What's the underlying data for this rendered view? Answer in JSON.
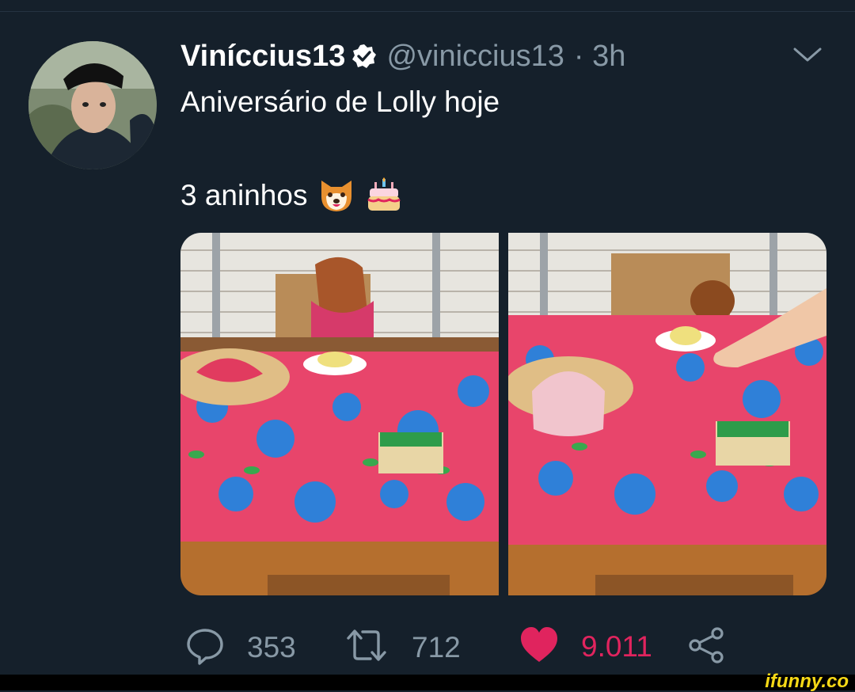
{
  "tweet": {
    "display_name": "Viníccius13",
    "handle": "@viniccius13",
    "time": "· 3h",
    "text_line1": "Aniversário de Lolly hoje",
    "text_line2": "3 aninhos"
  },
  "icons": {
    "verified": "verified-badge-icon",
    "menu": "chevron-down-icon",
    "emoji1": "dog-face-emoji",
    "emoji2": "birthday-cake-emoji",
    "reply": "reply-icon",
    "retweet": "retweet-icon",
    "like": "heart-icon",
    "share": "share-icon"
  },
  "stats": {
    "replies": "353",
    "retweets": "712",
    "likes": "9.011"
  },
  "watermark": "ifunny.co",
  "colors": {
    "background": "#15202b",
    "muted": "#8899a6",
    "like": "#e0245e",
    "verified": "#ffffff",
    "watermark": "#f7d916"
  }
}
